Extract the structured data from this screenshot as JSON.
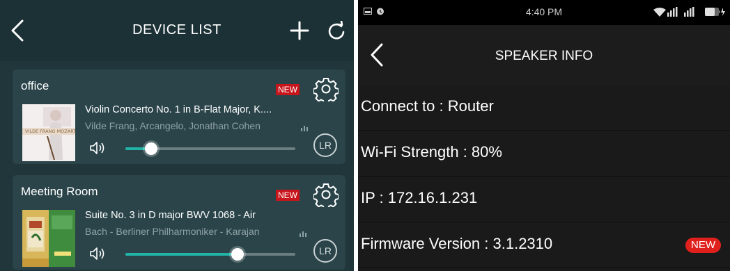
{
  "device_list": {
    "title": "DEVICE LIST",
    "devices": [
      {
        "name": "office",
        "new_badge": "NEW",
        "song": "Violin Concerto No. 1 in B-Flat Major, K....",
        "artist": "Vilde Frang, Arcangelo, Jonathan Cohen",
        "volume": 0.15,
        "channel": "LR",
        "album_art_text": "VILDE FRANG MOZART"
      },
      {
        "name": "Meeting Room",
        "new_badge": "NEW",
        "song": "Suite No. 3 in D major BWV 1068 - Air",
        "artist": "Bach - Berliner Philharmoniker - Karajan",
        "volume": 0.66,
        "channel": "LR",
        "album_art_text": ""
      }
    ]
  },
  "speaker_info": {
    "status_time": "4:40 PM",
    "title": "SPEAKER INFO",
    "rows": [
      {
        "text": "Connect to : Router"
      },
      {
        "text": "Wi-Fi Strength : 80%"
      },
      {
        "text": "IP : 172.16.1.231"
      },
      {
        "text": "Firmware Version : 3.1.2310",
        "badge": "NEW"
      }
    ]
  },
  "colors": {
    "accent": "#21b3a6",
    "badge_red": "#c8151b",
    "left_bg": "#20363b",
    "card_bg": "#2a4449",
    "right_bg": "#1a1a1a"
  }
}
